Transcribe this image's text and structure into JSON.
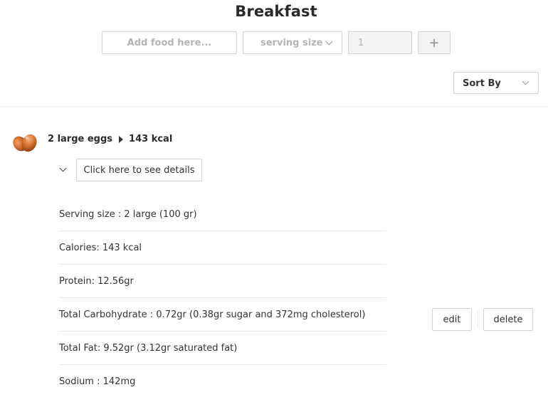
{
  "meal": {
    "title": "Breakfast"
  },
  "add_form": {
    "food_placeholder": "Add food here...",
    "serving_placeholder": "serving size",
    "quantity_value": "1",
    "add_label": "+"
  },
  "sort": {
    "label": "Sort By"
  },
  "entry": {
    "name": "2 large eggs",
    "calories": "143 kcal",
    "icon": "eggs-icon",
    "details_button": "Click here to see details",
    "details": [
      "Serving size : 2 large (100 gr)",
      "Calories: 143 kcal",
      "Protein: 12.56gr",
      "Total Carbohydrate : 0.72gr (0.38gr sugar and 372mg cholesterol)",
      "Total Fat: 9.52gr (3.12gr saturated fat)",
      "Sodium : 142mg"
    ],
    "edit_label": "edit",
    "delete_label": "delete"
  },
  "colors": {
    "border": "#d2d2d2",
    "disabled_bg": "#f3f3f3",
    "placeholder_text": "#b4b4b4",
    "egg_brown": "#c8692a"
  }
}
